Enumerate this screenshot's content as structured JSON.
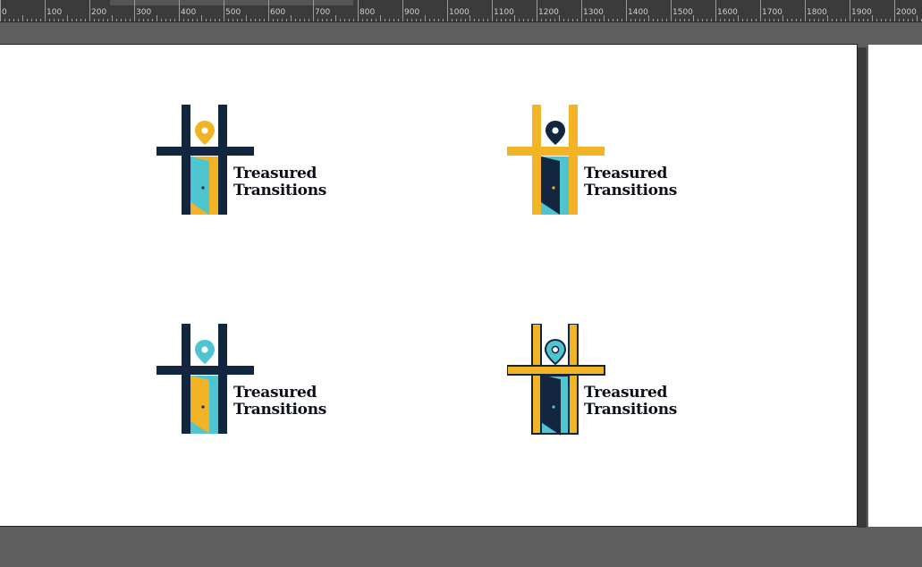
{
  "ruler": {
    "labels": [
      "0",
      "100",
      "200",
      "300",
      "400",
      "500",
      "600",
      "700",
      "800",
      "900",
      "1000",
      "1100",
      "1200",
      "1300",
      "1400",
      "1500",
      "1600",
      "1700",
      "1800",
      "1900",
      "2000"
    ]
  },
  "colors": {
    "navy": "#12263f",
    "gold": "#f2b324",
    "teal": "#4ec5cf",
    "canvas": "#5e5e5e",
    "ruler": "#3b3b3b"
  },
  "logos": [
    {
      "line1": "Treasured",
      "line2": "Transitions",
      "bars": "#12263f",
      "pin": "#f2b324",
      "doorFrame": "#f2b324",
      "doorPanel": "#4ec5cf",
      "knob": "#12263f",
      "outlined": false
    },
    {
      "line1": "Treasured",
      "line2": "Transitions",
      "bars": "#f2b324",
      "pin": "#12263f",
      "doorFrame": "#4ec5cf",
      "doorPanel": "#12263f",
      "knob": "#f2b324",
      "outlined": false
    },
    {
      "line1": "Treasured",
      "line2": "Transitions",
      "bars": "#12263f",
      "pin": "#4ec5cf",
      "doorFrame": "#4ec5cf",
      "doorPanel": "#f2b324",
      "knob": "#12263f",
      "outlined": false
    },
    {
      "line1": "Treasured",
      "line2": "Transitions",
      "bars": "#f2b324",
      "pin": "#4ec5cf",
      "doorFrame": "#4ec5cf",
      "doorPanel": "#12263f",
      "knob": "#4ec5cf",
      "outlined": true
    }
  ]
}
